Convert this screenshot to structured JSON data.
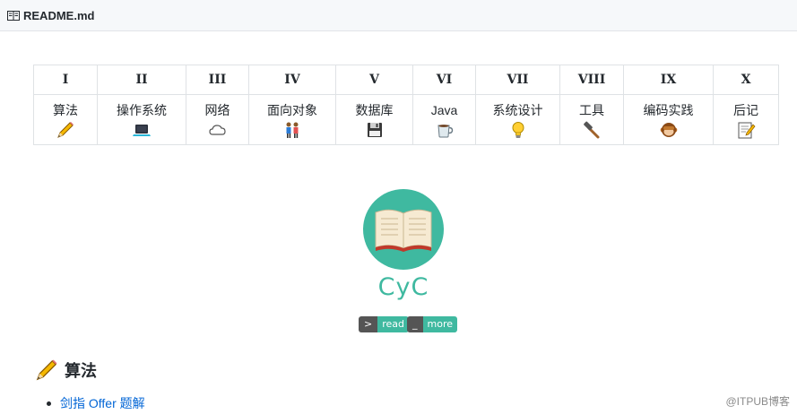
{
  "file_header": {
    "filename": "README.md",
    "icon": "book-icon"
  },
  "nav_table": {
    "headers": [
      "I",
      "II",
      "III",
      "IV",
      "V",
      "VI",
      "VII",
      "VIII",
      "IX",
      "X"
    ],
    "items": [
      {
        "label": "算法",
        "icon": "pencil-icon"
      },
      {
        "label": "操作系统",
        "icon": "laptop-icon"
      },
      {
        "label": "网络",
        "icon": "cloud-icon"
      },
      {
        "label": "面向对象",
        "icon": "couple-icon"
      },
      {
        "label": "数据库",
        "icon": "floppy-disk-icon"
      },
      {
        "label": "Java",
        "icon": "coffee-icon"
      },
      {
        "label": "系统设计",
        "icon": "bulb-icon"
      },
      {
        "label": "工具",
        "icon": "hammer-icon"
      },
      {
        "label": "编码实践",
        "icon": "monkey-icon"
      },
      {
        "label": "后记",
        "icon": "memo-icon"
      }
    ]
  },
  "logo": {
    "icon": "open-book-icon",
    "brand": "CyC",
    "color": "#3fb9a0"
  },
  "badges": [
    {
      "left": ">",
      "right": "read"
    },
    {
      "left": "_",
      "right": "more"
    }
  ],
  "section": {
    "title": "算法",
    "icon": "pencil-icon"
  },
  "links": [
    {
      "text": "剑指 Offer 题解"
    }
  ],
  "watermark": "@ITPUB博客"
}
